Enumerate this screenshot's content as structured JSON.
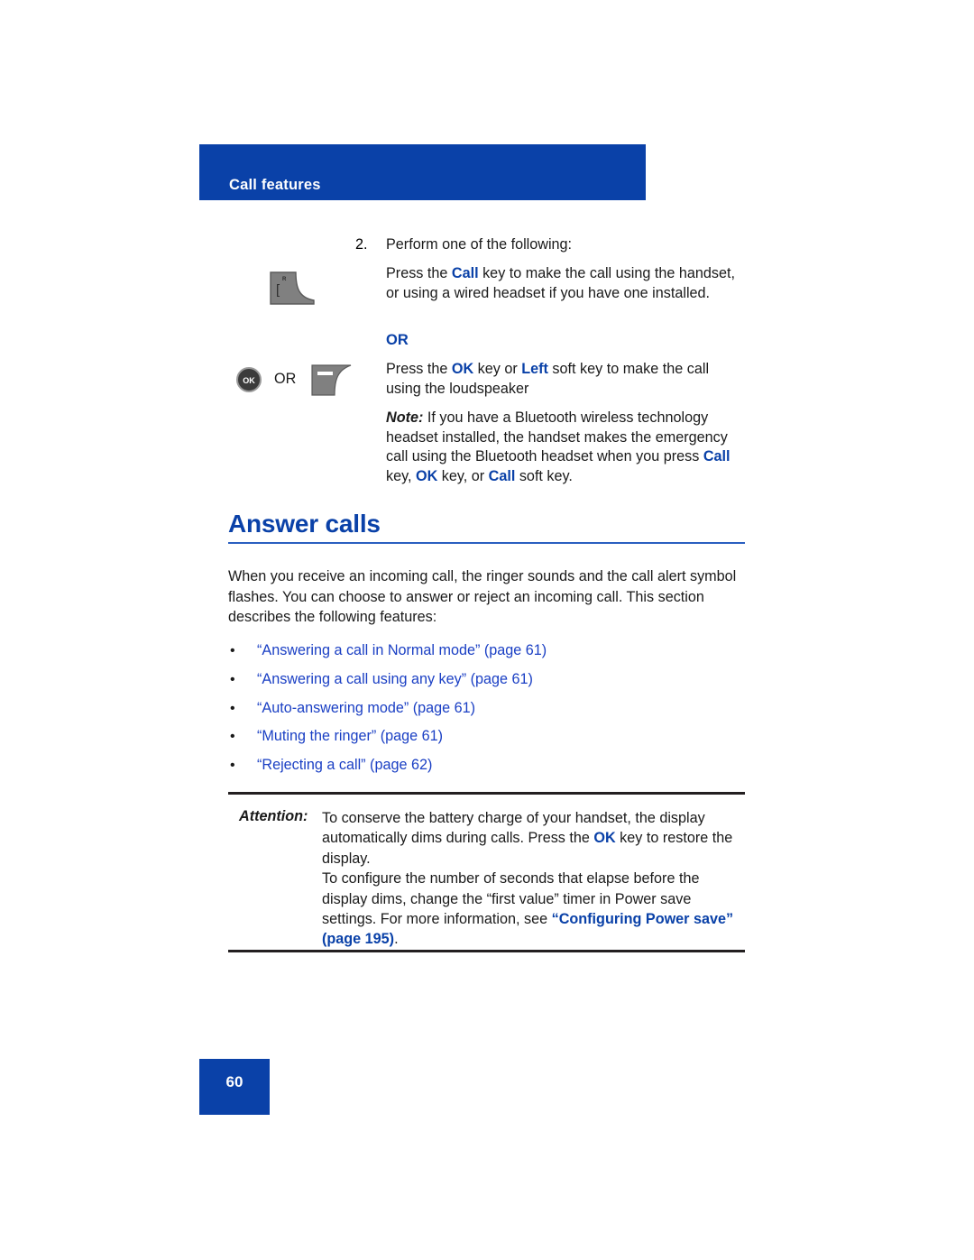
{
  "header": {
    "title": "Call features"
  },
  "step": {
    "number": "2.",
    "text": "Perform one of the following:"
  },
  "paragraphs": {
    "call_key": {
      "prefix": "Press the ",
      "key": "Call",
      "suffix": " key to make the call using the handset, or using a wired headset if you have one installed."
    },
    "or_label": "OR",
    "ok_key": {
      "prefix": "Press the ",
      "key1": "OK",
      "middle": " key or ",
      "key2": "Left",
      "suffix": " soft key to make the call using the loudspeaker"
    },
    "note": {
      "label": "Note:",
      "text_1": " If you have a Bluetooth wireless technology headset installed, the handset makes the emergency call using the Bluetooth headset when you press ",
      "key1": "Call",
      "text_2": " key, ",
      "key2": "OK",
      "text_3": " key, or ",
      "key3": "Call",
      "text_4": " soft key."
    }
  },
  "icons": {
    "call_key_glyph_r": "R",
    "call_key_glyph_bracket": "[",
    "ok_button_label": "OK",
    "or_between": "OR"
  },
  "section": {
    "heading": "Answer calls",
    "intro": "When you receive an incoming call, the ringer sounds and the call alert symbol flashes. You can choose to answer or reject an incoming call. This section describes the following features:",
    "bullets": [
      {
        "marker": "•",
        "text": "“Answering a call in Normal mode” (page 61)"
      },
      {
        "marker": "•",
        "text": "“Answering a call using any key” (page 61)"
      },
      {
        "marker": "•",
        "text": "“Auto-answering mode” (page 61)"
      },
      {
        "marker": "•",
        "text": "“Muting the ringer” (page 61)"
      },
      {
        "marker": "•",
        "text": "“Rejecting a call” (page 62)"
      }
    ]
  },
  "attention": {
    "label": "Attention:",
    "para1_a": "To conserve the battery charge of your handset, the display automatically dims during calls. Press the ",
    "para1_key": "OK",
    "para1_b": " key to restore the display.",
    "para2_a": "To configure the number of seconds that elapse before the display dims, change the “first value” timer in Power save settings. For more information, see ",
    "para2_link": "“Configuring Power save” (page 195)",
    "para2_b": "."
  },
  "footer": {
    "page_number": "60"
  },
  "colors": {
    "brand_blue": "#0A41A8",
    "link_blue": "#1a3fc4",
    "rule_dark": "#231f20",
    "key_gray": "#808080"
  }
}
